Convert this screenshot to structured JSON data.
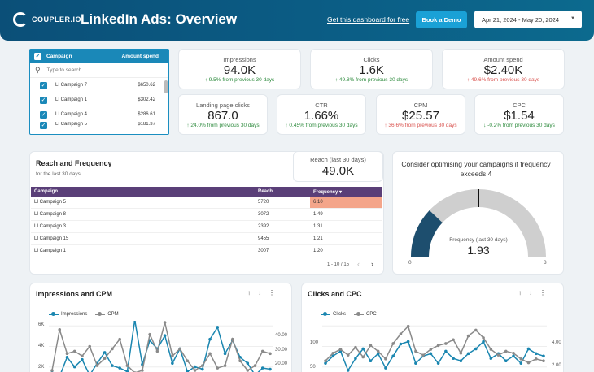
{
  "header": {
    "logo_text": "COUPLER.IO",
    "title": "LinkedIn Ads: Overview",
    "get_dashboard": "Get this dashboard for free",
    "book_demo": "Book a Demo",
    "date_range": "Apr 21, 2024 - May 20, 2024"
  },
  "filter": {
    "col_campaign": "Campaign",
    "col_amount": "Amount spend",
    "search_placeholder": "Type to search",
    "rows": [
      {
        "name": "LI Campaign 7",
        "amount": "$650.62"
      },
      {
        "name": "LI Campaign 1",
        "amount": "$302.42"
      },
      {
        "name": "LI Campaign 4",
        "amount": "$286.61"
      },
      {
        "name": "LI Campaign 5",
        "amount": "$181.37"
      }
    ]
  },
  "kpis": {
    "impressions": {
      "label": "Impressions",
      "value": "94.0K",
      "change": "↑ 9.5% from previous 30 days"
    },
    "clicks": {
      "label": "Clicks",
      "value": "1.6K",
      "change": "↑ 49.8% from previous 30 days"
    },
    "amount": {
      "label": "Amount spend",
      "value": "$2.40K",
      "change": "↑ 49.6% from previous 30 days"
    },
    "lpc": {
      "label": "Landing page clicks",
      "value": "867.0",
      "change": "↑ 24.0% from previous 30 days"
    },
    "ctr": {
      "label": "CTR",
      "value": "1.66%",
      "change": "↑ 0.45% from previous 30 days"
    },
    "cpm": {
      "label": "CPM",
      "value": "$25.57",
      "change": "↑ 36.6% from previous 30 days"
    },
    "cpc": {
      "label": "CPC",
      "value": "$1.54",
      "change": "↓ -0.2% from previous 30 days"
    }
  },
  "reach_frequency": {
    "title": "Reach and Frequency",
    "subtitle": "for the last 30 days",
    "reach_label": "Reach (last 30 days)",
    "reach_value": "49.0K",
    "columns": [
      "Campaign",
      "Reach",
      "Frequency ▾"
    ],
    "rows": [
      {
        "campaign": "LI Campaign 5",
        "reach": "5720",
        "frequency": "6.10"
      },
      {
        "campaign": "LI Campaign 8",
        "reach": "3072",
        "frequency": "1.49"
      },
      {
        "campaign": "LI Campaign 3",
        "reach": "2392",
        "frequency": "1.31"
      },
      {
        "campaign": "LI Campaign 15",
        "reach": "9455",
        "frequency": "1.21"
      },
      {
        "campaign": "LI Campaign 1",
        "reach": "3007",
        "frequency": "1.20"
      }
    ],
    "pager": "1 - 10 / 15",
    "highlight_color": "#f4a58a"
  },
  "gauge": {
    "title": "Consider optimising your campaigns if frequency exceeds 4",
    "label": "Frequency (last 30 days)",
    "value": 1.93,
    "value_text": "1.93",
    "min": 0,
    "max": 8,
    "min_text": "0",
    "max_text": "8",
    "threshold": 4,
    "fill_color": "#1d4e6e",
    "track_color": "#cfcfcf"
  },
  "charts": {
    "impressions_cpm": {
      "title": "Impressions and CPM",
      "legend_a": "Impressions",
      "legend_b": "CPM",
      "left_ticks": [
        "6K",
        "4K",
        "2K"
      ],
      "right_ticks": [
        "40.00",
        "30.00",
        "20.00"
      ]
    },
    "clicks_cpc": {
      "title": "Clicks and CPC",
      "legend_a": "Clicks",
      "legend_b": "CPC",
      "left_ticks": [
        "100",
        "50"
      ],
      "right_ticks": [
        "4.00",
        "2.00"
      ]
    },
    "series_color_a": "#1a86b0",
    "series_color_b": "#8a8a8a"
  },
  "chart_data": [
    {
      "type": "line",
      "title": "Impressions and CPM",
      "series": [
        {
          "name": "Impressions",
          "values": [
            1800,
            1500,
            3100,
            2300,
            2900,
            1600,
            2600,
            3500,
            2400,
            2200,
            1900,
            6200,
            2500,
            4500,
            3800,
            4900,
            2600,
            3800,
            1900,
            2300,
            2100,
            4600,
            5600,
            3400,
            4500,
            3100,
            2600,
            1600,
            2200,
            2100
          ]
        },
        {
          "name": "CPM",
          "values": [
            20,
            37,
            27,
            28,
            26,
            30,
            22,
            25,
            29,
            33,
            22,
            19,
            20,
            35,
            28,
            40,
            26,
            29,
            24,
            20,
            22,
            27,
            21,
            22,
            33,
            24,
            20,
            22,
            28,
            27
          ]
        }
      ],
      "ylim": [
        2000,
        6000
      ],
      "y2lim": [
        20,
        40
      ]
    },
    {
      "type": "line",
      "title": "Clicks and CPC",
      "series": [
        {
          "name": "Clicks",
          "values": [
            40,
            55,
            65,
            25,
            50,
            70,
            45,
            60,
            30,
            55,
            80,
            85,
            40,
            55,
            60,
            40,
            65,
            50,
            45,
            60,
            70,
            85,
            50,
            60,
            45,
            55,
            40,
            70,
            60,
            55
          ]
        },
        {
          "name": "CPC",
          "values": [
            2.0,
            2.8,
            3.2,
            2.6,
            3.4,
            2.4,
            3.6,
            3.0,
            2.2,
            3.8,
            4.8,
            5.6,
            3.0,
            2.6,
            3.2,
            3.6,
            3.8,
            4.2,
            2.8,
            4.6,
            5.2,
            4.4,
            3.2,
            2.6,
            3.0,
            2.8,
            2.2,
            1.8,
            2.2,
            2.0
          ]
        }
      ],
      "ylim": [
        25,
        125
      ],
      "y2lim": [
        1,
        6
      ]
    }
  ]
}
